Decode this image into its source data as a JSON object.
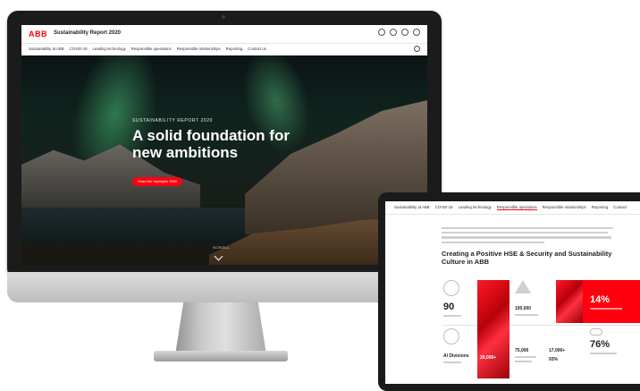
{
  "desktop": {
    "logo": "ABB",
    "site_title": "Sustainability Report 2020",
    "nav": [
      "Sustainability at ABB",
      "COVID-19",
      "Leading technology",
      "Responsible operations",
      "Responsible relationships",
      "Reporting",
      "Contact us"
    ],
    "hero": {
      "kicker": "SUSTAINABILITY REPORT 2020",
      "headline": "A solid foundation for new ambitions",
      "cta": "Read the highlights 2020",
      "scroll": "SCROLL"
    }
  },
  "tablet": {
    "nav": [
      "Sustainability at ABB",
      "COVID-19",
      "Leading technology",
      "Responsible operations",
      "Responsible relationships",
      "Reporting",
      "Contact"
    ],
    "heading": "Creating a Positive HSE & Security and Sustainability Culture in ABB",
    "stats": {
      "s1": "90",
      "s2": "Al Divisions",
      "s3": "100,000",
      "s4": "75,000",
      "s5": "17,000+",
      "s6": "93%",
      "s7": "14%",
      "s8": "76%",
      "s9": "20,000+"
    }
  },
  "colors": {
    "brand_red": "#ff000f"
  }
}
